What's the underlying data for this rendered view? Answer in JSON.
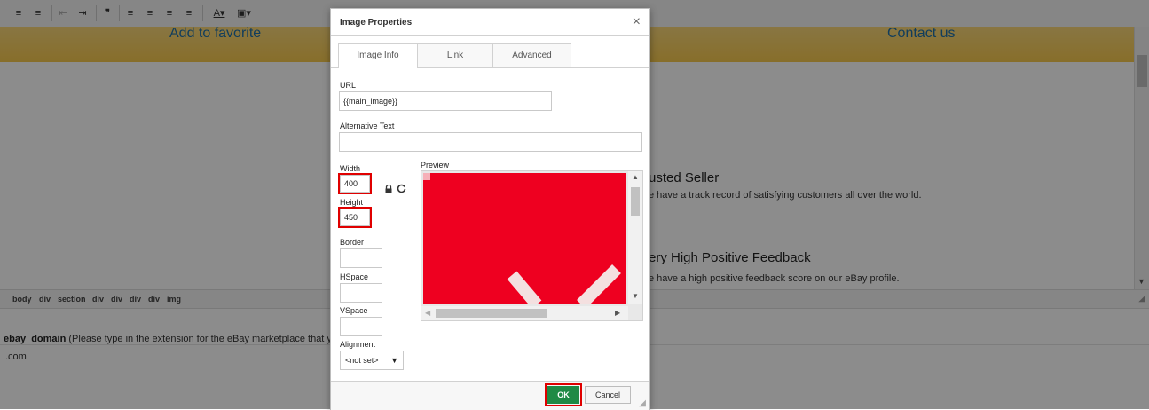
{
  "editor": {
    "banner": {
      "left_link": "Add to favorite",
      "right_link": "Contact us"
    },
    "features": [
      {
        "title": "usted Seller",
        "desc": "e have a track record of satisfying customers all over the world."
      },
      {
        "title": "ery High Positive Feedback",
        "desc": "e have a high positive feedback score on our eBay profile."
      }
    ],
    "path": [
      "body",
      "div",
      "section",
      "div",
      "div",
      "div",
      "div",
      "img"
    ],
    "field": {
      "name": "ebay_domain",
      "hint": " (Please type in the extension for the eBay marketplace that y",
      "value": ".com"
    }
  },
  "dialog": {
    "title": "Image Properties",
    "close_glyph": "×",
    "tabs": [
      {
        "label": "Image Info",
        "active": true
      },
      {
        "label": "Link",
        "active": false
      },
      {
        "label": "Advanced",
        "active": false
      }
    ],
    "url": {
      "label": "URL",
      "value": "{{main_image}}"
    },
    "alt_text": {
      "label": "Alternative Text",
      "value": ""
    },
    "width": {
      "label": "Width",
      "value": "400"
    },
    "height": {
      "label": "Height",
      "value": "450"
    },
    "border": {
      "label": "Border",
      "value": ""
    },
    "hspace": {
      "label": "HSpace",
      "value": ""
    },
    "vspace": {
      "label": "VSpace",
      "value": ""
    },
    "alignment": {
      "label": "Alignment",
      "value": "<not set>"
    },
    "preview": {
      "label": "Preview"
    },
    "buttons": {
      "ok": "OK",
      "cancel": "Cancel"
    }
  },
  "colors": {
    "accent_ok": "#1f8a45",
    "highlight": "#e00000",
    "preview_fill": "#ee0020",
    "banner": "#f6c94e"
  },
  "icons": [
    "lock-icon",
    "reset-icon",
    "close-icon",
    "resize-grip-icon"
  ]
}
